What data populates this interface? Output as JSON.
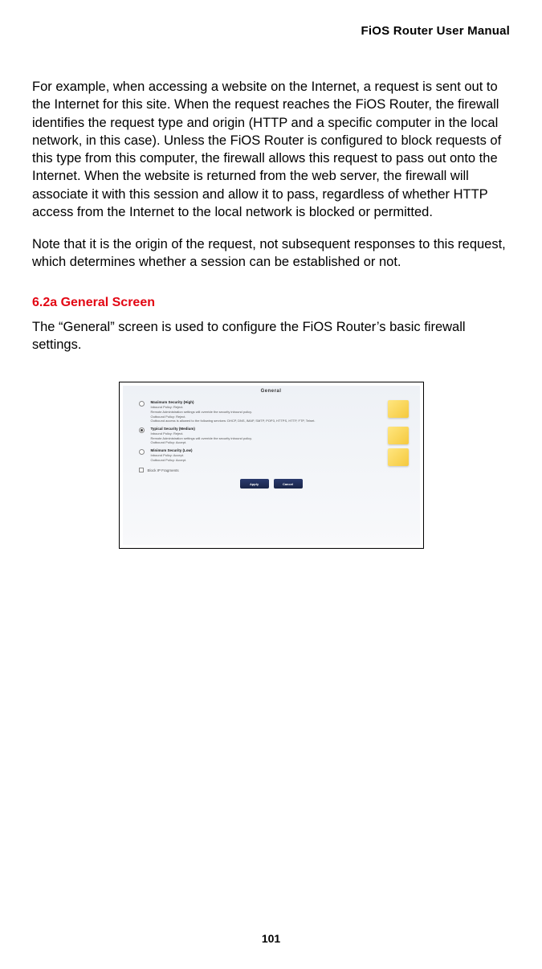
{
  "header": {
    "title": "FiOS Router User Manual"
  },
  "body": {
    "para1": "For example, when accessing a website on the Internet, a request is sent out to the Internet for this site. When the request reaches the FiOS Router, the firewall identifies the request type and origin (HTTP and a specific computer in the local network, in this case). Unless the FiOS Router is configured to block requests of this type from this computer, the firewall allows this request to pass out onto the Internet. When the website is returned from the web server, the firewall will associate it with this session and allow it to pass, regardless of whether HTTP access from the Internet to the local network is blocked or permitted.",
    "para2": "Note that it is the origin of the request, not subsequent responses to this request, which determines whether a session can be established or not.",
    "section_heading": "6.2a  General Screen",
    "para3": "The “General” screen is used to configure the FiOS Router’s basic firewall settings."
  },
  "screenshot": {
    "title": "General",
    "options": [
      {
        "heading": "Maximum Security (High)",
        "desc1": "Inbound Policy: Reject.",
        "desc2": "Remote Administration settings will override the security inbound policy.",
        "desc3": "Outbound Policy: Reject.",
        "desc4": "Outbound access is allowed to the following services: DHCP, DNS, IMAP, SMTP, POP3, HTTPS, HTTP, FTP, Telnet."
      },
      {
        "heading": "Typical Security (Medium)",
        "desc1": "Inbound Policy: Reject.",
        "desc2": "Remote Administration settings will override the security inbound policy.",
        "desc3": "Outbound Policy: Accept."
      },
      {
        "heading": "Minimum Security (Low)",
        "desc1": "Inbound Policy: Accept.",
        "desc2": "Outbound Policy: Accept."
      }
    ],
    "checkbox_label": "Block IP Fragments",
    "buttons": {
      "apply": "Apply",
      "cancel": "Cancel"
    }
  },
  "page_number": "101"
}
